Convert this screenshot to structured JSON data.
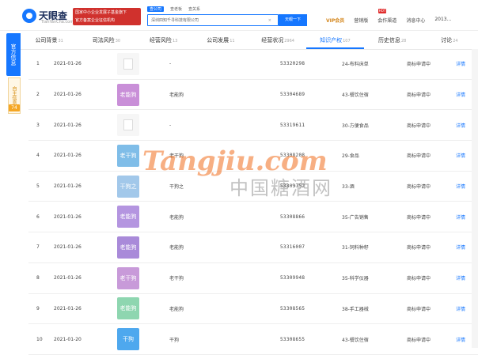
{
  "header": {
    "logo_title": "天眼查",
    "logo_sub": "TianYanCha.com",
    "ad_line1": "国家中小企业发展子基金旗下",
    "ad_line2": "官方备案企业征信机构",
    "search_tabs": [
      "查公司",
      "查老板",
      "查关系"
    ],
    "search_value": "深圳四知千寻科技有限公司",
    "search_clear": "×",
    "search_button": "天眼一下",
    "vip_label": "VIP会员",
    "links": [
      "营销版",
      "会作渠道",
      "消息中心",
      "2013..."
    ],
    "hot_badge": "HOT"
  },
  "side": {
    "tab1": "官方信息",
    "tab2": "自主信息",
    "badge": "74"
  },
  "tabs": [
    {
      "label": "公司背景",
      "count": "31"
    },
    {
      "label": "司法风险",
      "count": "30"
    },
    {
      "label": "经营风险",
      "count": "13"
    },
    {
      "label": "公司发展",
      "count": "11"
    },
    {
      "label": "经营状况",
      "count": "2964"
    },
    {
      "label": "知识产权",
      "count": "107"
    },
    {
      "label": "历史信息",
      "count": "28"
    },
    {
      "label": "讨论",
      "count": "24"
    }
  ],
  "active_tab_index": 5,
  "rows": [
    {
      "idx": "1",
      "date": "2021-01-26",
      "logo": "",
      "name": "-",
      "reg": "53320298",
      "cls": "24-布料床单",
      "status": "商标申请中",
      "op": "详情"
    },
    {
      "idx": "2",
      "date": "2021-01-26",
      "logo": "老能狗",
      "name": "老能狗",
      "reg": "53304689",
      "cls": "43-餐饮住宿",
      "status": "商标申请中",
      "op": "详情"
    },
    {
      "idx": "3",
      "date": "2021-01-26",
      "logo": "",
      "name": "-",
      "reg": "53319611",
      "cls": "30-方便食品",
      "status": "商标申请中",
      "op": "详情"
    },
    {
      "idx": "4",
      "date": "2021-01-26",
      "logo": "老干狗",
      "name": "老干狗",
      "reg": "53308208",
      "cls": "29-食品",
      "status": "商标申请中",
      "op": "详情"
    },
    {
      "idx": "5",
      "date": "2021-01-26",
      "logo": "干狗之",
      "name": "干狗之",
      "reg": "53303752",
      "cls": "33-酒",
      "status": "商标申请中",
      "op": "详情"
    },
    {
      "idx": "6",
      "date": "2021-01-26",
      "logo": "老能狗",
      "name": "老能狗",
      "reg": "53308866",
      "cls": "35-广告销售",
      "status": "商标申请中",
      "op": "详情"
    },
    {
      "idx": "7",
      "date": "2021-01-26",
      "logo": "老能狗",
      "name": "老能狗",
      "reg": "53316007",
      "cls": "31-饲料种籽",
      "status": "商标申请中",
      "op": "详情"
    },
    {
      "idx": "8",
      "date": "2021-01-26",
      "logo": "老干狗",
      "name": "老干狗",
      "reg": "53309948",
      "cls": "35-科学仪器",
      "status": "商标申请中",
      "op": "详情"
    },
    {
      "idx": "9",
      "date": "2021-01-26",
      "logo": "老能狗",
      "name": "老能狗",
      "reg": "53308565",
      "cls": "38-手工器械",
      "status": "商标申请中",
      "op": "详情"
    },
    {
      "idx": "10",
      "date": "2021-01-20",
      "logo": "干狗",
      "name": "干狗",
      "reg": "53308655",
      "cls": "43-餐饮住宿",
      "status": "商标申请中",
      "op": "详情"
    }
  ],
  "logo_colors": [
    "",
    "#c98fd8",
    "",
    "#7fbde8",
    "#a2c8ea",
    "#b495e0",
    "#a98ad9",
    "#c89ad9",
    "#8ed6b0",
    "#4ea8ee"
  ],
  "accent": "#1677ff",
  "watermark": {
    "en": "Tangjiu.com",
    "cn": "中国糖酒网"
  }
}
